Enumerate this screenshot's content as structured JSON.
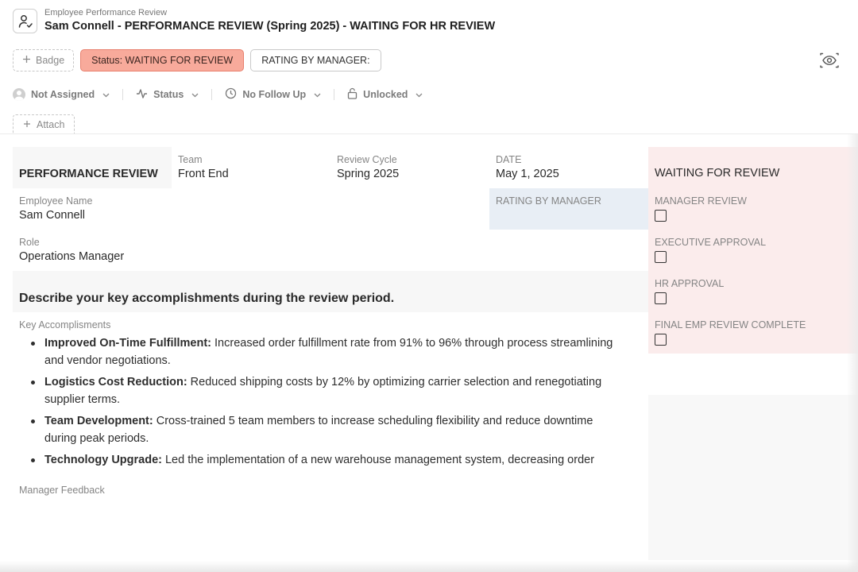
{
  "header": {
    "breadcrumb": "Employee Performance Review",
    "title": "Sam Connell - PERFORMANCE REVIEW (Spring 2025) - WAITING FOR HR REVIEW",
    "icon": "user-check-icon"
  },
  "badges": {
    "add_label": "Badge",
    "status_label": "Status: WAITING FOR REVIEW",
    "rating_label": "RATING BY MANAGER:",
    "status_color": "#f8aa9b"
  },
  "properties": {
    "assignee": "Not Assigned",
    "status": "Status",
    "follow_up": "No Follow Up",
    "lock": "Unlocked"
  },
  "attach_label": "Attach",
  "form": {
    "section_title": "PERFORMANCE REVIEW",
    "team_label": "Team",
    "team_value": "Front End",
    "cycle_label": "Review Cycle",
    "cycle_value": "Spring 2025",
    "date_label": "DATE",
    "date_value": "May 1, 2025",
    "employee_label": "Employee Name",
    "employee_value": "Sam Connell",
    "rating_label": "RATING BY MANAGER",
    "role_label": "Role",
    "role_value": "Operations Manager",
    "question": "Describe your key accomplishments during the review period.",
    "accomplishments_label": "Key Accomplisments",
    "accomplishments": [
      {
        "title": "Improved On-Time Fulfillment:",
        "text": " Increased order fulfillment rate from 91% to 96% through process streamlining and vendor negotiations."
      },
      {
        "title": "Logistics Cost Reduction:",
        "text": " Reduced shipping costs by 12% by optimizing carrier selection and renegotiating supplier terms."
      },
      {
        "title": "Team Development:",
        "text": " Cross-trained 5 team members to increase scheduling flexibility and reduce downtime during peak periods."
      },
      {
        "title": "Technology Upgrade:",
        "text": " Led the implementation of a new warehouse management system, decreasing order"
      }
    ],
    "manager_feedback_label": "Manager Feedback"
  },
  "panel": {
    "title": "WAITING FOR REVIEW",
    "background": "#fbecec",
    "checks": [
      {
        "label": "MANAGER REVIEW",
        "checked": false
      },
      {
        "label": "EXECUTIVE APPROVAL",
        "checked": false
      },
      {
        "label": "HR APPROVAL",
        "checked": false
      },
      {
        "label": "FINAL EMP REVIEW COMPLETE",
        "checked": false
      }
    ]
  }
}
